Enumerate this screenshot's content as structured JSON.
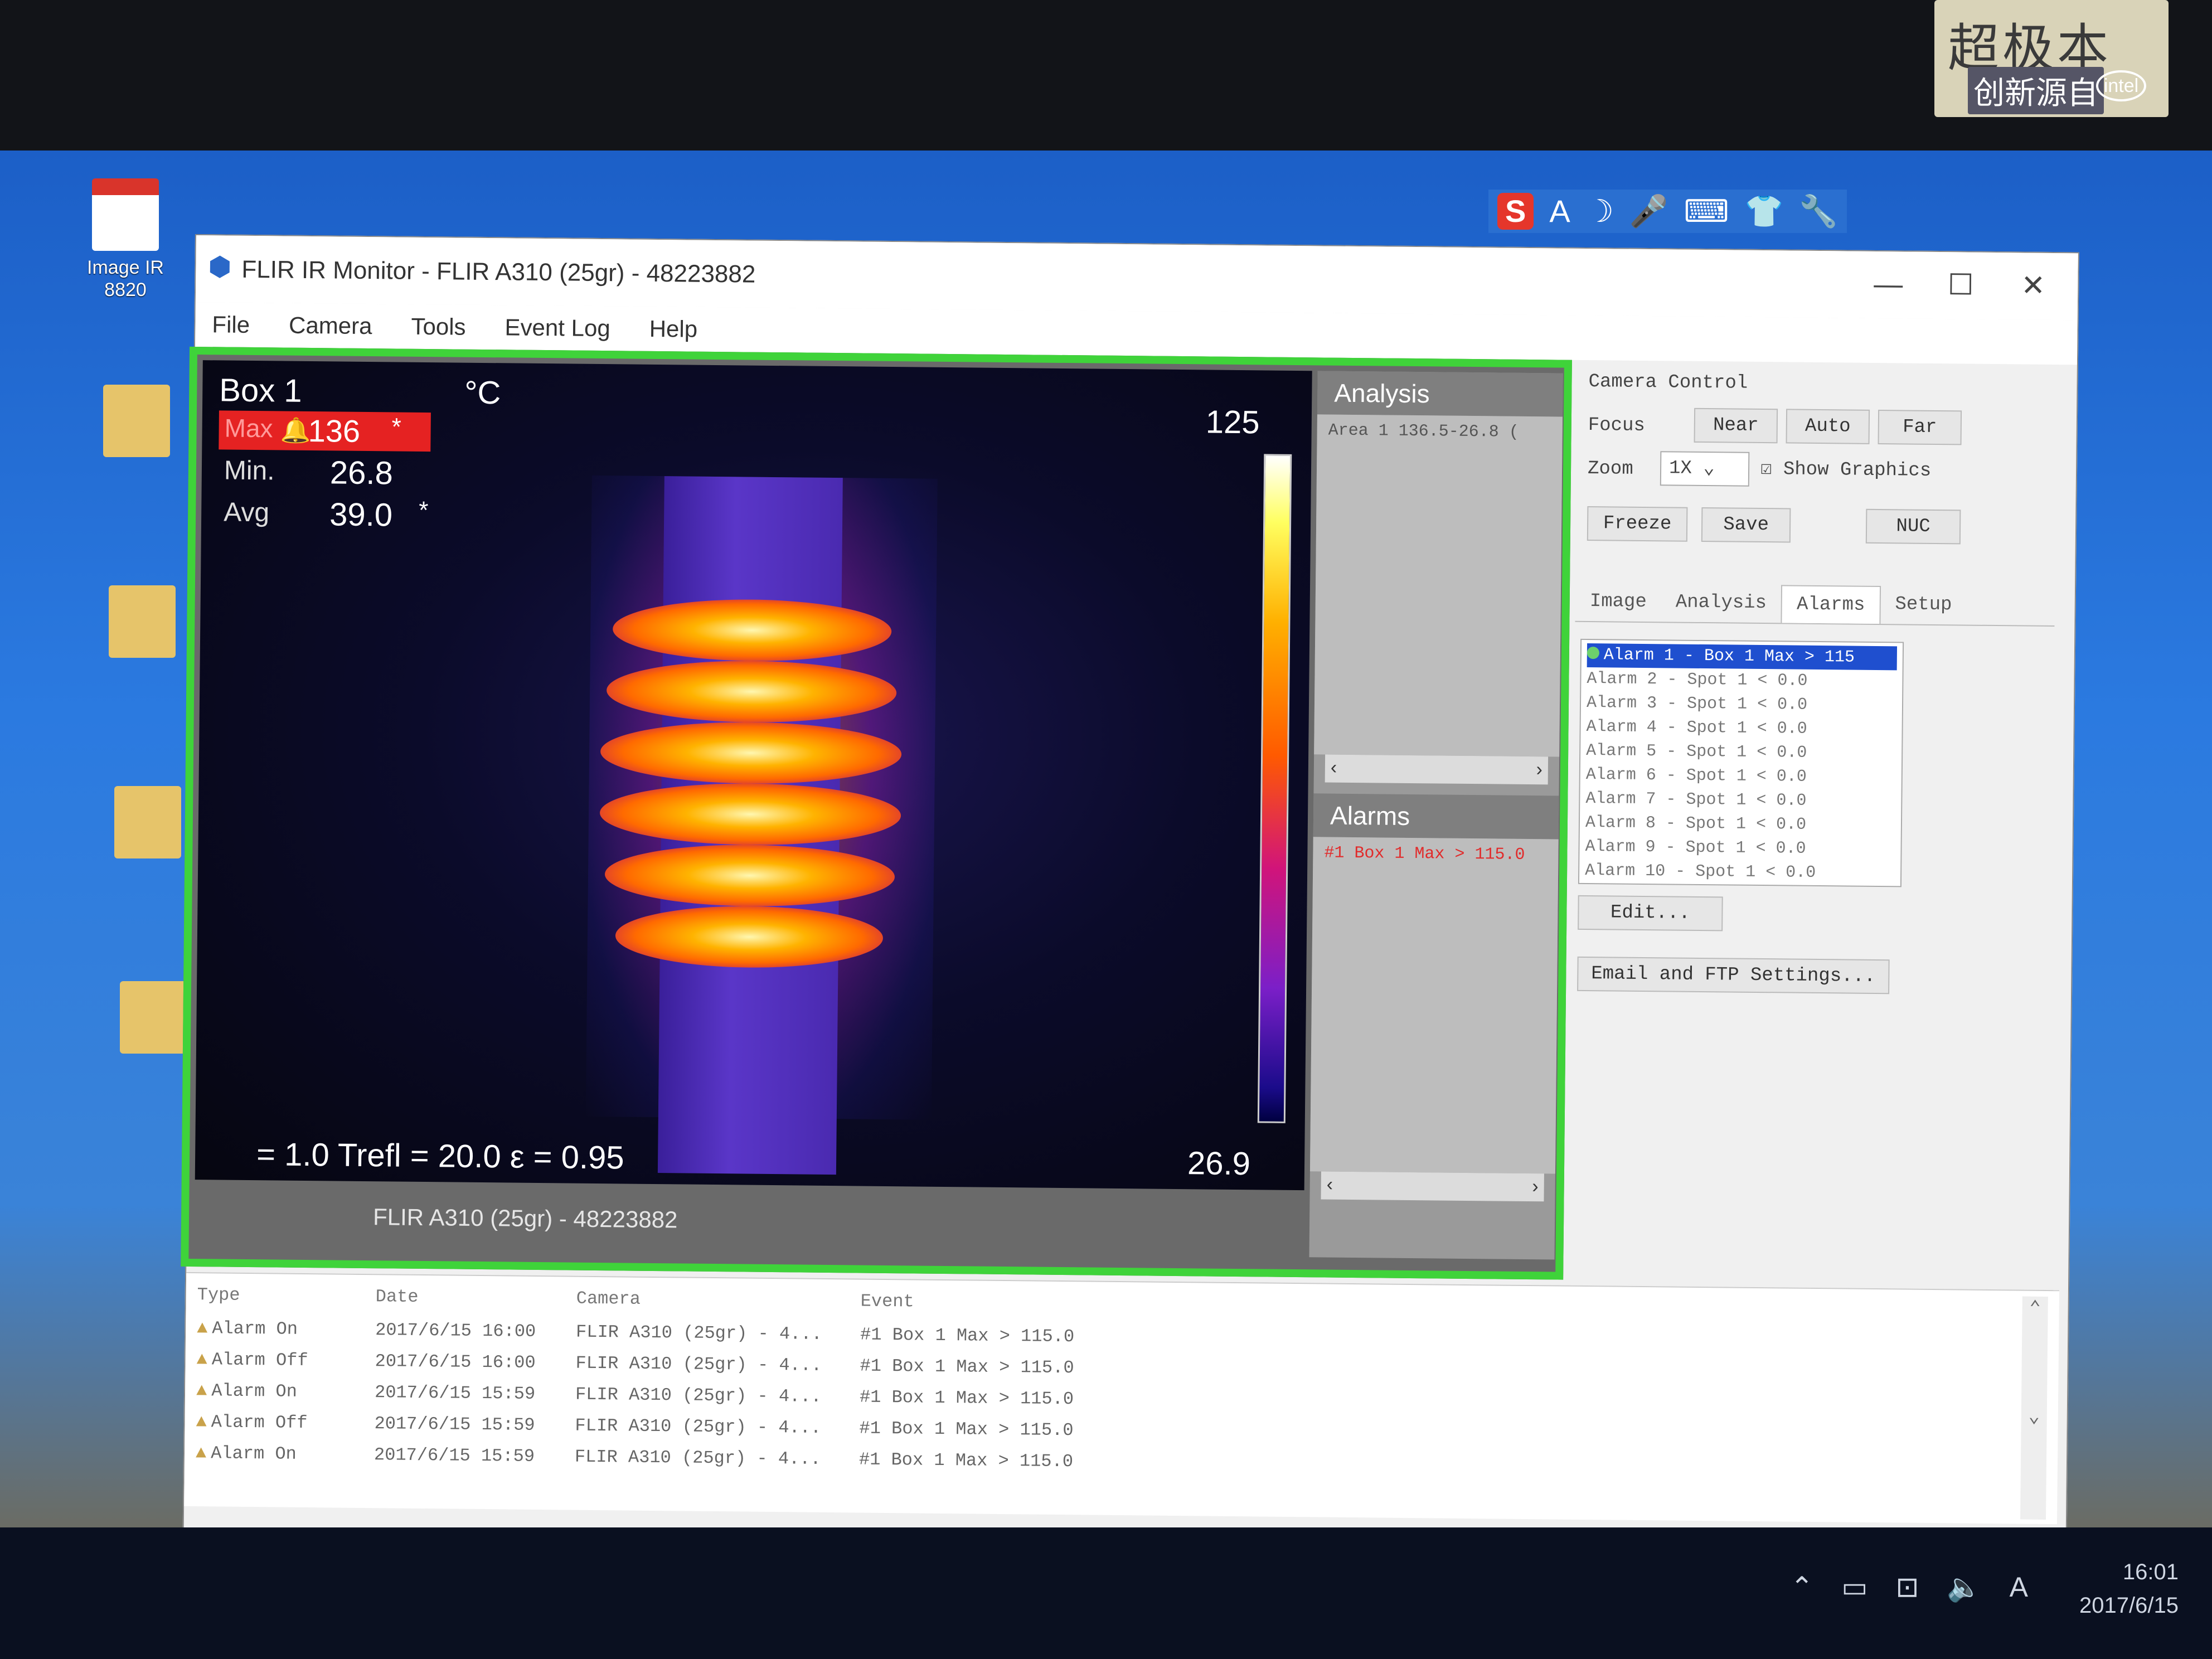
{
  "sticker": {
    "brand_text": "超极本",
    "slogan": "创新源自",
    "logo": "intel"
  },
  "desktop": {
    "icons": [
      {
        "label": "Image IR 8820",
        "glyph": "pdf"
      },
      {
        "label": "",
        "glyph": "folder"
      },
      {
        "label": "",
        "glyph": "folder"
      },
      {
        "label": "",
        "glyph": "folder"
      },
      {
        "label": "",
        "glyph": "folder"
      }
    ]
  },
  "window": {
    "title": "FLIR IR Monitor - FLIR A310 (25gr) - 48223882",
    "controls": {
      "minimize": "—",
      "maximize": "☐",
      "close": "✕"
    },
    "menu": [
      "File",
      "Camera",
      "Tools",
      "Event Log",
      "Help"
    ]
  },
  "thermal": {
    "box_label": "Box 1",
    "unit": "°C",
    "max_label": "Max",
    "max_value": "136",
    "max_flag": "*",
    "min_label": "Min.",
    "min_value": "26.8",
    "avg_label": "Avg",
    "avg_value": "39.0",
    "avg_flag": "*",
    "scale_top": "125",
    "scale_bottom": "26.9",
    "params": "= 1.0  Trefl = 20.0  ε = 0.95",
    "status": "FLIR A310 (25gr) - 48223882"
  },
  "analysis_panel": {
    "title": "Analysis",
    "row": "Area 1 136.5-26.8 (",
    "alarms_title": "Alarms",
    "alarm_row": "#1 Box 1 Max > 115.0"
  },
  "camera_control": {
    "title": "Camera Control",
    "focus_label": "Focus",
    "near": "Near",
    "auto": "Auto",
    "far": "Far",
    "zoom_label": "Zoom",
    "zoom_value": "1X",
    "show_graphics": "Show Graphics",
    "freeze": "Freeze",
    "save": "Save",
    "nuc": "NUC",
    "tabs": [
      "Image",
      "Analysis",
      "Alarms",
      "Setup"
    ],
    "alarms": [
      "Alarm 1 - Box 1 Max > 115",
      "Alarm 2 - Spot 1  < 0.0",
      "Alarm 3 - Spot 1  < 0.0",
      "Alarm 4 - Spot 1  < 0.0",
      "Alarm 5 - Spot 1  < 0.0",
      "Alarm 6 - Spot 1  < 0.0",
      "Alarm 7 - Spot 1  < 0.0",
      "Alarm 8 - Spot 1  < 0.0",
      "Alarm 9 - Spot 1  < 0.0",
      "Alarm 10 - Spot 1  < 0.0"
    ],
    "edit": "Edit...",
    "email_ftp": "Email and FTP Settings..."
  },
  "event_log": {
    "headers": [
      "Type",
      "Date",
      "Camera",
      "Event"
    ],
    "rows": [
      [
        "Alarm On",
        "2017/6/15 16:00",
        "FLIR A310 (25gr) - 4...",
        "#1 Box 1 Max > 115.0"
      ],
      [
        "Alarm Off",
        "2017/6/15 16:00",
        "FLIR A310 (25gr) - 4...",
        "#1 Box 1 Max > 115.0"
      ],
      [
        "Alarm On",
        "2017/6/15 15:59",
        "FLIR A310 (25gr) - 4...",
        "#1 Box 1 Max > 115.0"
      ],
      [
        "Alarm Off",
        "2017/6/15 15:59",
        "FLIR A310 (25gr) - 4...",
        "#1 Box 1 Max > 115.0"
      ],
      [
        "Alarm On",
        "2017/6/15 15:59",
        "FLIR A310 (25gr) - 4...",
        "#1 Box 1 Max > 115.0"
      ]
    ]
  },
  "taskbar": {
    "time": "16:01",
    "date": "2017/6/15",
    "ime_indicator": "A"
  },
  "colors": {
    "viewer_border": "#3fd33a",
    "alarm_red": "#e52222",
    "selection_blue": "#1f4fcf"
  }
}
